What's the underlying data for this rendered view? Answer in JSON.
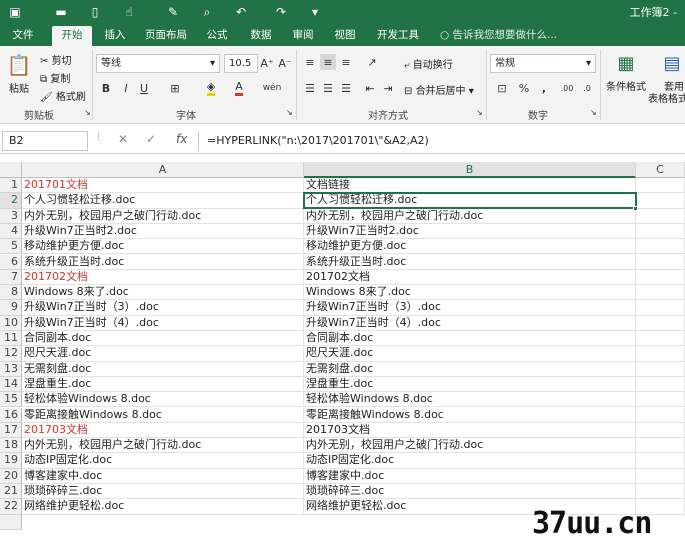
{
  "titlebar": {
    "doc_title": "工作簿2 -",
    "icons": [
      "save-icon",
      "open-folder-icon",
      "new-document-icon",
      "touch-mode-icon",
      "format-brush-icon",
      "print-preview-icon",
      "undo-icon",
      "redo-icon",
      "customize-icon"
    ]
  },
  "menu": {
    "tabs": [
      {
        "label": "文件"
      },
      {
        "label": "开始"
      },
      {
        "label": "插入"
      },
      {
        "label": "页面布局"
      },
      {
        "label": "公式"
      },
      {
        "label": "数据"
      },
      {
        "label": "审阅"
      },
      {
        "label": "视图"
      },
      {
        "label": "开发工具"
      }
    ],
    "active_tab": "开始",
    "tell_me": "告诉我您想要做什么..."
  },
  "ribbon": {
    "paste": "粘贴",
    "cut": "剪切",
    "copy": "复制",
    "format_painter": "格式刷",
    "clipboard_label": "剪贴板",
    "font_name": "等线",
    "font_size": "10.5",
    "bold": "B",
    "italic": "I",
    "underline": "U",
    "font_label": "字体",
    "wrap_text": "自动换行",
    "merge_center": "合并后居中",
    "alignment_label": "对齐方式",
    "number_format": "常规",
    "number_label": "数字",
    "conditional_format": "条件格式",
    "table_format_line1": "套用",
    "table_format_line2": "表格格式"
  },
  "formula_bar": {
    "name_box": "B2",
    "fx": "fx",
    "formula": "=HYPERLINK(\"n:\\2017\\201701\\\"&A2,A2)"
  },
  "sheet": {
    "columns": [
      "A",
      "B",
      "C"
    ],
    "selected_cell": "B2",
    "rows": [
      {
        "n": "1",
        "a": "201701文档",
        "b": "文档链接",
        "red": true
      },
      {
        "n": "2",
        "a": "个人习惯轻松迁移.doc",
        "b": "个人习惯轻松迁移.doc"
      },
      {
        "n": "3",
        "a": "内外无别，校园用户之破门行动.doc",
        "b": "内外无别，校园用户之破门行动.doc"
      },
      {
        "n": "4",
        "a": "升级Win7正当时2.doc",
        "b": "升级Win7正当时2.doc"
      },
      {
        "n": "5",
        "a": "移动维护更方便.doc",
        "b": "移动维护更方便.doc"
      },
      {
        "n": "6",
        "a": "系统升级正当时.doc",
        "b": "系统升级正当时.doc"
      },
      {
        "n": "7",
        "a": "201702文档",
        "b": "201702文档",
        "red": true
      },
      {
        "n": "8",
        "a": "Windows 8来了.doc",
        "b": "Windows 8来了.doc"
      },
      {
        "n": "9",
        "a": "升级Win7正当时（3）.doc",
        "b": "升级Win7正当时（3）.doc"
      },
      {
        "n": "10",
        "a": "升级Win7正当时（4）.doc",
        "b": "升级Win7正当时（4）.doc"
      },
      {
        "n": "11",
        "a": "合同副本.doc",
        "b": "合同副本.doc"
      },
      {
        "n": "12",
        "a": "咫尺天涯.doc",
        "b": "咫尺天涯.doc"
      },
      {
        "n": "13",
        "a": "无需刻盘.doc",
        "b": "无需刻盘.doc"
      },
      {
        "n": "14",
        "a": "涅盘重生.doc",
        "b": "涅盘重生.doc"
      },
      {
        "n": "15",
        "a": "轻松体验Windows 8.doc",
        "b": "轻松体验Windows 8.doc"
      },
      {
        "n": "16",
        "a": "零距离接触Windows 8.doc",
        "b": "零距离接触Windows 8.doc"
      },
      {
        "n": "17",
        "a": "201703文档",
        "b": "201703文档",
        "red": true
      },
      {
        "n": "18",
        "a": "内外无别，校园用户之破门行动.doc",
        "b": "内外无别，校园用户之破门行动.doc"
      },
      {
        "n": "19",
        "a": "动态IP固定化.doc",
        "b": "动态IP固定化.doc"
      },
      {
        "n": "20",
        "a": "博客建家中.doc",
        "b": "博客建家中.doc"
      },
      {
        "n": "21",
        "a": "琐琐碎碎三.doc",
        "b": "琐琐碎碎三.doc"
      },
      {
        "n": "22",
        "a": "网络维护更轻松.doc",
        "b": "网络维护更轻松.doc"
      }
    ]
  },
  "watermark": "37uu.cn",
  "colors": {
    "accent": "#217346",
    "red_text": "#d6332a"
  }
}
